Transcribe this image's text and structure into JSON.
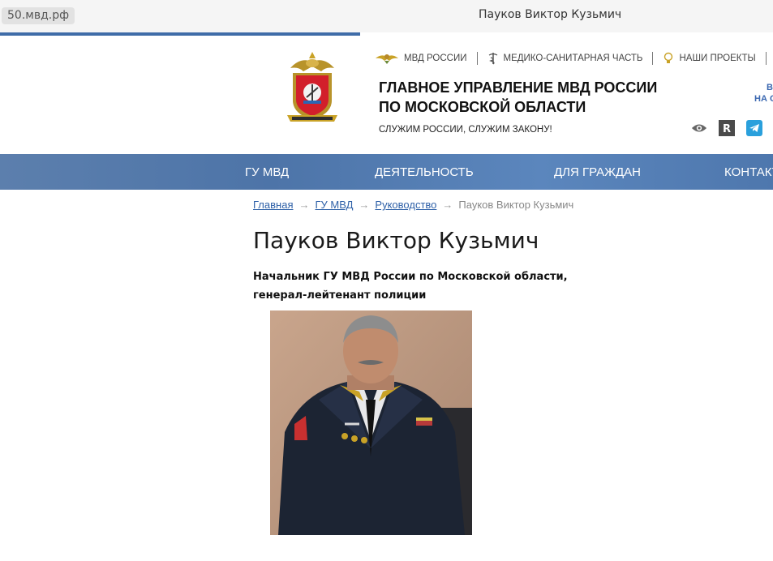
{
  "browser": {
    "url": "50.мвд.рф",
    "tab_title": "Пауков Виктор Кузьмич"
  },
  "header": {
    "top_links": [
      {
        "label": "МВД РОССИИ",
        "icon": "eagle-icon"
      },
      {
        "label": "МЕДИКО-САНИТАРНАЯ ЧАСТЬ",
        "icon": "caduceus-icon"
      },
      {
        "label": "НАШИ ПРОЕКТЫ",
        "icon": "lightbulb-icon"
      }
    ],
    "org_line1": "ГЛАВНОЕ УПРАВЛЕНИЕ МВД РОССИИ",
    "org_line2": "ПО МОСКОВСКОЙ ОБЛАСТИ",
    "motto": "СЛУЖИМ РОССИИ, СЛУЖИМ ЗАКОНУ!",
    "cut_line1": "В",
    "cut_line2": "НА С",
    "tools": [
      "eye-icon",
      "r-icon",
      "telegram-icon"
    ]
  },
  "main_nav": {
    "items": [
      "ГУ МВД",
      "ДЕЯТЕЛЬНОСТЬ",
      "ДЛЯ ГРАЖДАН",
      "КОНТАКТ"
    ]
  },
  "breadcrumb": {
    "links": [
      "Главная",
      "ГУ МВД",
      "Руководство"
    ],
    "current": "Пауков Виктор Кузьмич",
    "separator": "→"
  },
  "page": {
    "title": "Пауков Виктор Кузьмич",
    "position_line1": "Начальник ГУ МВД России по Московской области,",
    "position_line2": "генерал-лейтенант полиции"
  },
  "colors": {
    "nav_bar": "#5077ab",
    "link": "#2f61a8",
    "accent_blue": "#3f6ca8"
  }
}
